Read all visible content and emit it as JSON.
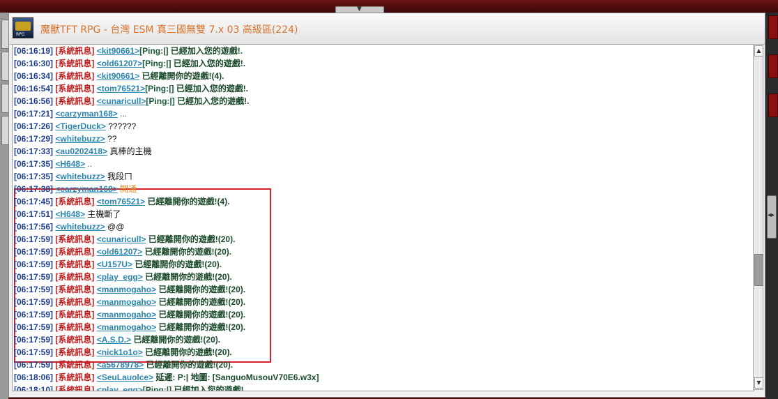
{
  "window": {
    "title": "魔獸TFT RPG - 台灣 ESM 真三國無雙 7.x 03 高級區(224)",
    "icon_name": "warcraft-rpg-icon"
  },
  "colors": {
    "timestamp": "#1e3f8f",
    "system_tag": "#c01e1e",
    "username": "#2a86b0",
    "highlight_border": "#d41f2d",
    "title_text": "#d8722a"
  },
  "chat": {
    "messages": [
      {
        "time": "[06:16:19]",
        "tag": "[系統訊息]",
        "user": "<kit90661>",
        "ping": "[Ping:|]",
        "text": " 已經加入您的遊戲!."
      },
      {
        "time": "[06:16:30]",
        "tag": "[系統訊息]",
        "user": "<old61207>",
        "ping": "[Ping:|]",
        "text": " 已經加入您的遊戲!."
      },
      {
        "time": "[06:16:34]",
        "tag": "[系統訊息]",
        "user": "<kit90661>",
        "ping": "",
        "text": " 已經離開你的遊戲!(4)."
      },
      {
        "time": "[06:16:54]",
        "tag": "[系統訊息]",
        "user": "<tom76521>",
        "ping": "[Ping:|]",
        "text": " 已經加入您的遊戲!."
      },
      {
        "time": "[06:16:56]",
        "tag": "[系統訊息]",
        "user": "<cunaricull>",
        "ping": "[Ping:|]",
        "text": " 已經加入您的遊戲!."
      },
      {
        "time": "[06:17:21]",
        "tag": "",
        "user": "<carzyman168>",
        "ping": "",
        "text": " ..."
      },
      {
        "time": "[06:17:26]",
        "tag": "",
        "user": "<TigerDuck>",
        "ping": "",
        "text": " ??????"
      },
      {
        "time": "[06:17:29]",
        "tag": "",
        "user": "<whitebuzz>",
        "ping": "",
        "text": " ??"
      },
      {
        "time": "[06:17:33]",
        "tag": "",
        "user": "<au0202418>",
        "ping": "",
        "text": " 真棒的主機"
      },
      {
        "time": "[06:17:35]",
        "tag": "",
        "user": "<H648>",
        "ping": "",
        "text": " .."
      },
      {
        "time": "[06:17:35]",
        "tag": "",
        "user": "<whitebuzz>",
        "ping": "",
        "text": " 我段ㄇ"
      },
      {
        "time": "[06:17:38]",
        "tag": "",
        "user": "<carzyman168>",
        "ping": "",
        "text": " 開通"
      },
      {
        "time": "[06:17:45]",
        "tag": "[系統訊息]",
        "user": "<tom76521>",
        "ping": "",
        "text": " 已經離開你的遊戲!(4)."
      },
      {
        "time": "[06:17:51]",
        "tag": "",
        "user": "<H648>",
        "ping": "",
        "text": " 主機斷了"
      },
      {
        "time": "[06:17:56]",
        "tag": "",
        "user": "<whitebuzz>",
        "ping": "",
        "text": " @@"
      },
      {
        "time": "[06:17:59]",
        "tag": "[系統訊息]",
        "user": "<cunaricull>",
        "ping": "",
        "text": " 已經離開你的遊戲!(20)."
      },
      {
        "time": "[06:17:59]",
        "tag": "[系統訊息]",
        "user": "<old61207>",
        "ping": "",
        "text": " 已經離開你的遊戲!(20)."
      },
      {
        "time": "[06:17:59]",
        "tag": "[系統訊息]",
        "user": "<U157U>",
        "ping": "",
        "text": " 已經離開你的遊戲!(20)."
      },
      {
        "time": "[06:17:59]",
        "tag": "[系統訊息]",
        "user": "<play_egg>",
        "ping": "",
        "text": " 已經離開你的遊戲!(20)."
      },
      {
        "time": "[06:17:59]",
        "tag": "[系統訊息]",
        "user": "<manmogaho>",
        "ping": "",
        "text": " 已經離開你的遊戲!(20)."
      },
      {
        "time": "[06:17:59]",
        "tag": "[系統訊息]",
        "user": "<manmogaho>",
        "ping": "",
        "text": " 已經離開你的遊戲!(20)."
      },
      {
        "time": "[06:17:59]",
        "tag": "[系統訊息]",
        "user": "<manmogaho>",
        "ping": "",
        "text": " 已經離開你的遊戲!(20)."
      },
      {
        "time": "[06:17:59]",
        "tag": "[系統訊息]",
        "user": "<manmogaho>",
        "ping": "",
        "text": " 已經離開你的遊戲!(20)."
      },
      {
        "time": "[06:17:59]",
        "tag": "[系統訊息]",
        "user": "<A.S.D.>",
        "ping": "",
        "text": " 已經離開你的遊戲!(20)."
      },
      {
        "time": "[06:17:59]",
        "tag": "[系統訊息]",
        "user": "<nick1o1o>",
        "ping": "",
        "text": " 已經離開你的遊戲!(20)."
      },
      {
        "time": "[06:17:59]",
        "tag": "[系統訊息]",
        "user": "<a5678978>",
        "ping": "",
        "text": " 已經離開你的遊戲!(20)."
      },
      {
        "time": "[06:18:06]",
        "tag": "[系統訊息]",
        "user": "<SeuLauolce>",
        "ping": "",
        "text": " 延遲: P:| 地圖: [SanguoMusouV70E6.w3x]"
      },
      {
        "time": "[06:18:10]",
        "tag": "[系統訊息]",
        "user": "<play_egg>",
        "ping": "[Ping:|]",
        "text": " 已經加入您的遊戲!."
      }
    ]
  }
}
